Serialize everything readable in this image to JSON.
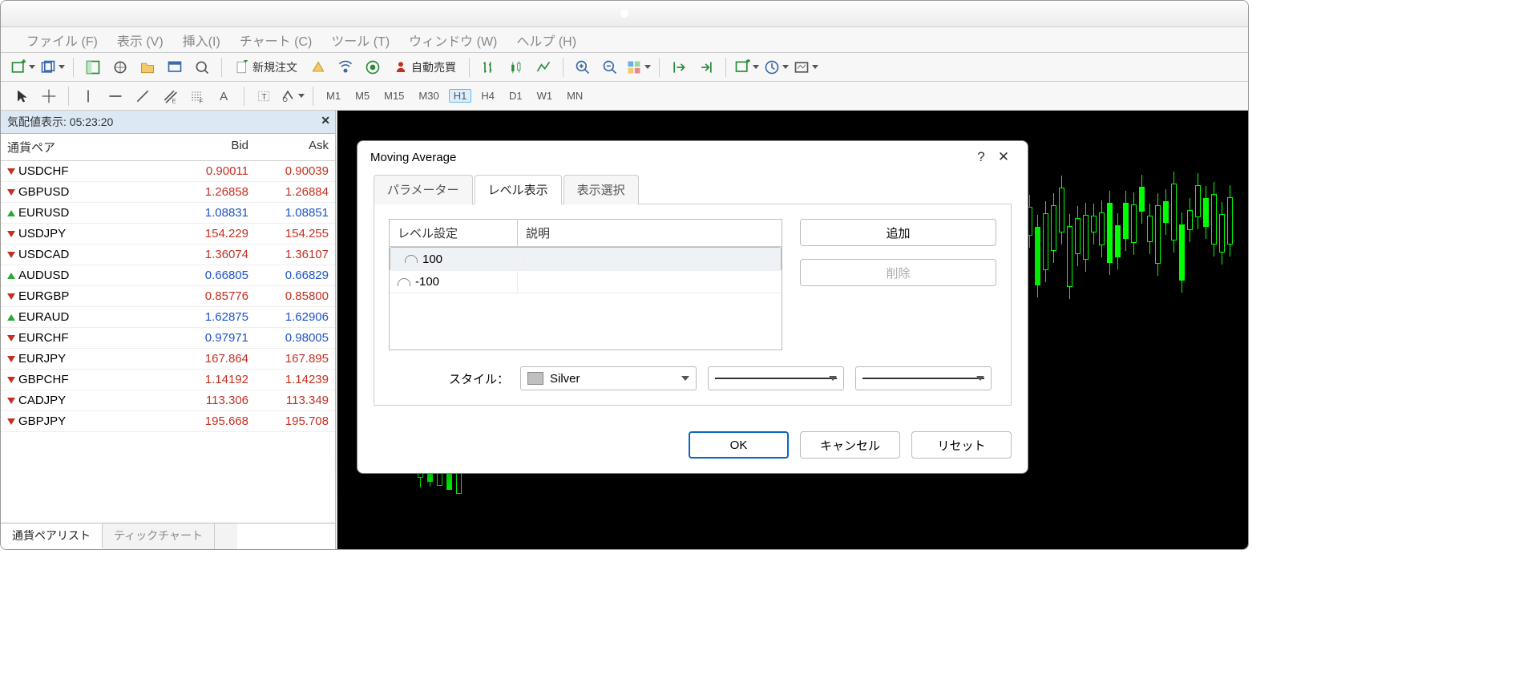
{
  "menu": {
    "file": "ファイル (F)",
    "view": "表示 (V)",
    "insert": "挿入(I)",
    "chart": "チャート (C)",
    "tool": "ツール (T)",
    "window": "ウィンドウ (W)",
    "help": "ヘルプ (H)"
  },
  "toolbar": {
    "new_order": "新規注文",
    "auto_trade": "自動売買"
  },
  "timeframes": [
    "M1",
    "M5",
    "M15",
    "M30",
    "H1",
    "H4",
    "D1",
    "W1",
    "MN"
  ],
  "active_tf": "H1",
  "market_watch": {
    "title": "気配値表示: 05:23:20",
    "cols": {
      "pair": "通貨ペア",
      "bid": "Bid",
      "ask": "Ask"
    },
    "rows": [
      {
        "dir": "dn",
        "pair": "USDCHF",
        "bid": "0.90011",
        "ask": "0.90039",
        "cls": "dn"
      },
      {
        "dir": "dn",
        "pair": "GBPUSD",
        "bid": "1.26858",
        "ask": "1.26884",
        "cls": "dn"
      },
      {
        "dir": "up",
        "pair": "EURUSD",
        "bid": "1.08831",
        "ask": "1.08851",
        "cls": "up"
      },
      {
        "dir": "dn",
        "pair": "USDJPY",
        "bid": "154.229",
        "ask": "154.255",
        "cls": "dn"
      },
      {
        "dir": "dn",
        "pair": "USDCAD",
        "bid": "1.36074",
        "ask": "1.36107",
        "cls": "dn"
      },
      {
        "dir": "up",
        "pair": "AUDUSD",
        "bid": "0.66805",
        "ask": "0.66829",
        "cls": "up"
      },
      {
        "dir": "dn",
        "pair": "EURGBP",
        "bid": "0.85776",
        "ask": "0.85800",
        "cls": "dn"
      },
      {
        "dir": "up",
        "pair": "EURAUD",
        "bid": "1.62875",
        "ask": "1.62906",
        "cls": "up"
      },
      {
        "dir": "dn",
        "pair": "EURCHF",
        "bid": "0.97971",
        "ask": "0.98005",
        "cls": "up"
      },
      {
        "dir": "dn",
        "pair": "EURJPY",
        "bid": "167.864",
        "ask": "167.895",
        "cls": "dn"
      },
      {
        "dir": "dn",
        "pair": "GBPCHF",
        "bid": "1.14192",
        "ask": "1.14239",
        "cls": "dn"
      },
      {
        "dir": "dn",
        "pair": "CADJPY",
        "bid": "113.306",
        "ask": "113.349",
        "cls": "dn"
      },
      {
        "dir": "dn",
        "pair": "GBPJPY",
        "bid": "195.668",
        "ask": "195.708",
        "cls": "dn"
      }
    ],
    "tabs": {
      "list": "通貨ペアリスト",
      "tick": "ティックチャート"
    }
  },
  "dialog": {
    "title": "Moving Average",
    "tabs": {
      "param": "パラメーター",
      "levels": "レベル表示",
      "vis": "表示選択"
    },
    "col_level": "レベル設定",
    "col_desc": "説明",
    "rows": [
      {
        "v": "100"
      },
      {
        "v": "-100"
      }
    ],
    "add": "追加",
    "del": "削除",
    "style_label": "スタイル：",
    "color_name": "Silver",
    "ok": "OK",
    "cancel": "キャンセル",
    "reset": "リセット"
  }
}
